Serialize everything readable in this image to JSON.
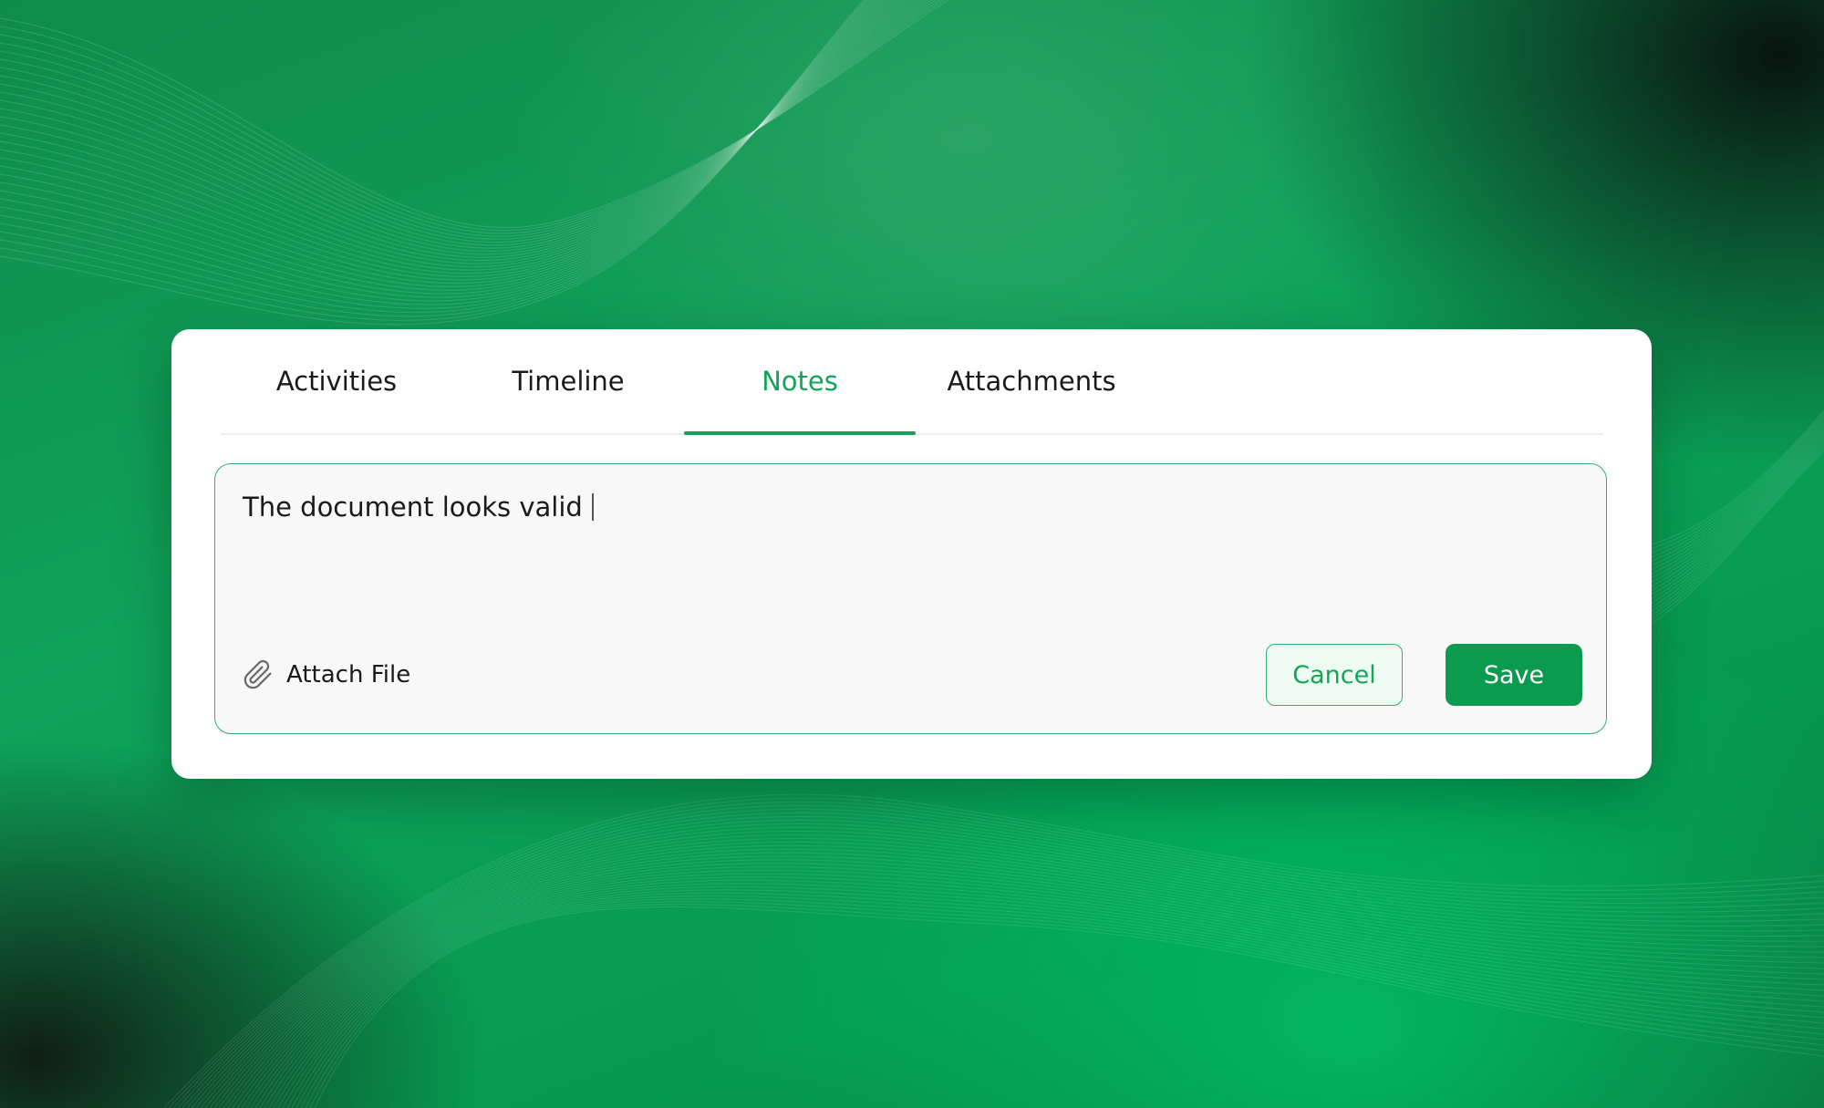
{
  "tabs": [
    {
      "label": "Activities",
      "active": false
    },
    {
      "label": "Timeline",
      "active": false
    },
    {
      "label": "Notes",
      "active": true
    },
    {
      "label": "Attachments",
      "active": false
    }
  ],
  "editor": {
    "value": "The document looks valid"
  },
  "attach": {
    "label": "Attach File",
    "icon": "paperclip-icon"
  },
  "actions": {
    "cancel_label": "Cancel",
    "save_label": "Save"
  },
  "colors": {
    "accent": "#12a556",
    "save_button": "#0a9b4e",
    "background": "#0fa35a"
  }
}
